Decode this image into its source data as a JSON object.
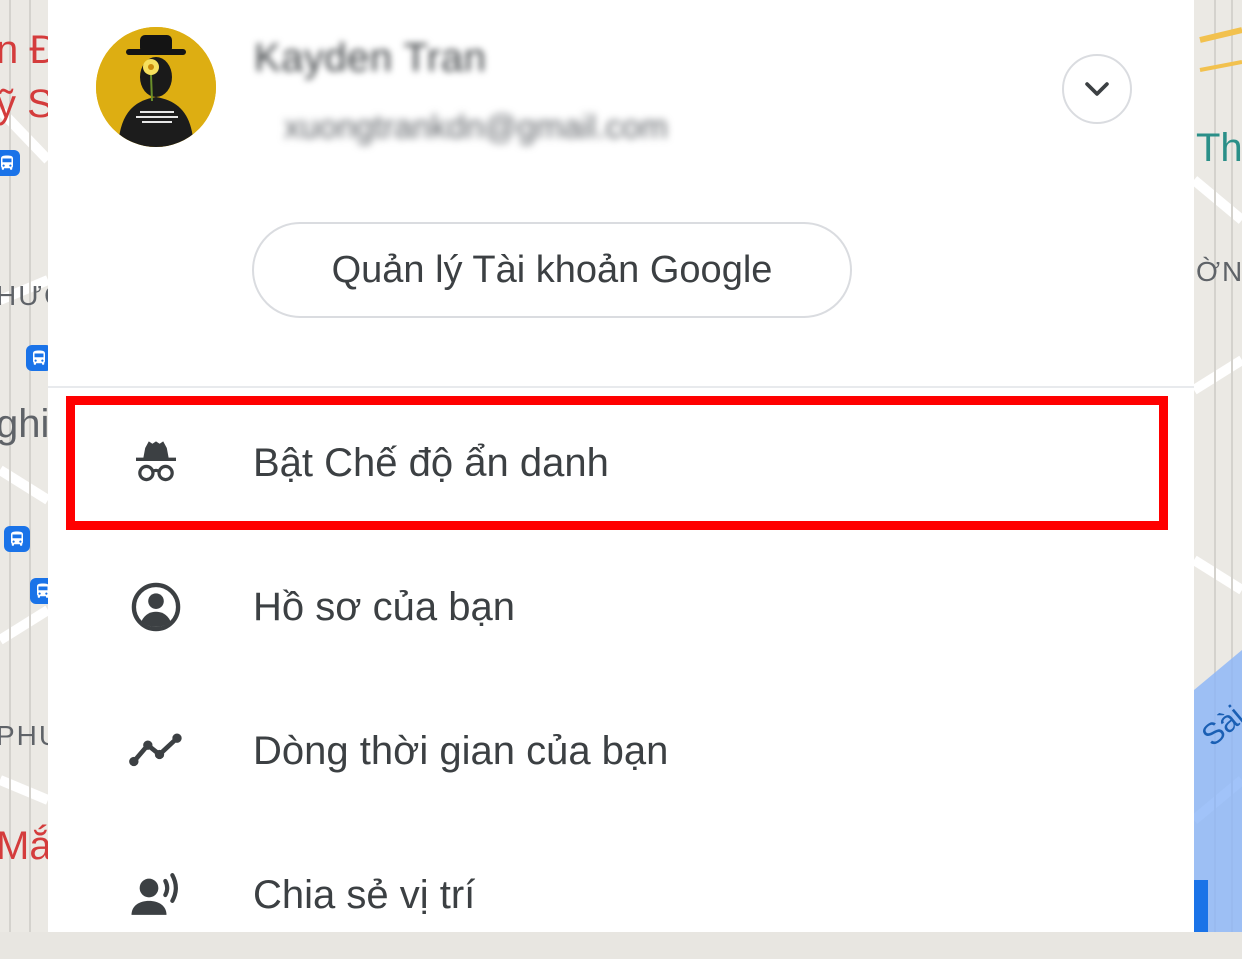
{
  "account": {
    "name": "Kayden Tran",
    "email": "xuongtrankdn@gmail.com",
    "manage_button": "Quản lý Tài khoản Google"
  },
  "menu": [
    {
      "label": "Bật Chế độ ẩn danh",
      "icon": "incognito-icon",
      "highlighted": true
    },
    {
      "label": "Hồ sơ của bạn",
      "icon": "account-circle-icon"
    },
    {
      "label": "Dòng thời gian của bạn",
      "icon": "timeline-icon"
    },
    {
      "label": "Chia sẻ vị trí",
      "icon": "location-sharing-icon"
    }
  ],
  "map_labels": {
    "left": [
      "n Đ",
      "ỹ S",
      "HƯƠ",
      "ghi",
      "PHU",
      "Mắt"
    ],
    "right": [
      "Thá",
      "ỜNG",
      "Sài C"
    ]
  },
  "colors": {
    "highlight": "#ff0000",
    "text": "#3c4043",
    "icon": "#3c4043",
    "divider": "#e8eaed"
  }
}
